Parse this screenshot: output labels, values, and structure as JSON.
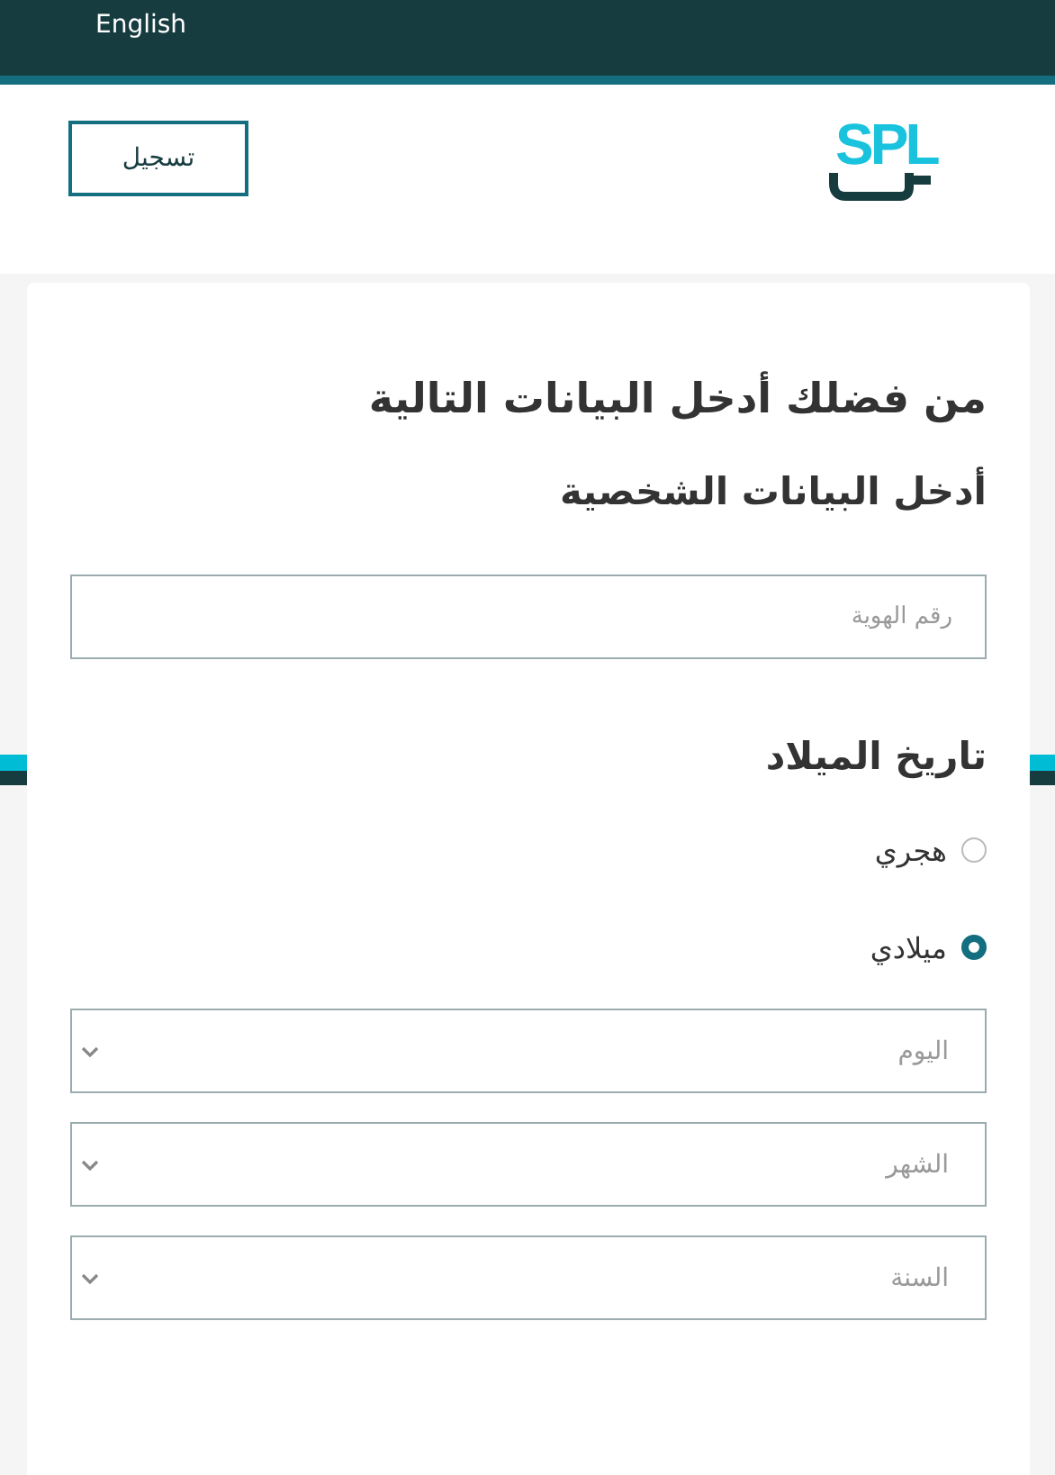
{
  "top_bar": {
    "language_link": "English"
  },
  "header": {
    "logo": {
      "text": "SPL"
    },
    "register_button": "تسجيل"
  },
  "form": {
    "title": "من فضلك أدخل البيانات التالية",
    "section_title": "أدخل البيانات الشخصية",
    "id_field": {
      "placeholder": "رقم الهوية"
    },
    "birth_date": {
      "title": "تاريخ الميلاد",
      "calendar_options": [
        {
          "label": "هجري",
          "selected": false
        },
        {
          "label": "ميلادي",
          "selected": true
        }
      ],
      "selects": [
        {
          "placeholder": "اليوم"
        },
        {
          "placeholder": "الشهر"
        },
        {
          "placeholder": "السنة"
        }
      ]
    }
  }
}
